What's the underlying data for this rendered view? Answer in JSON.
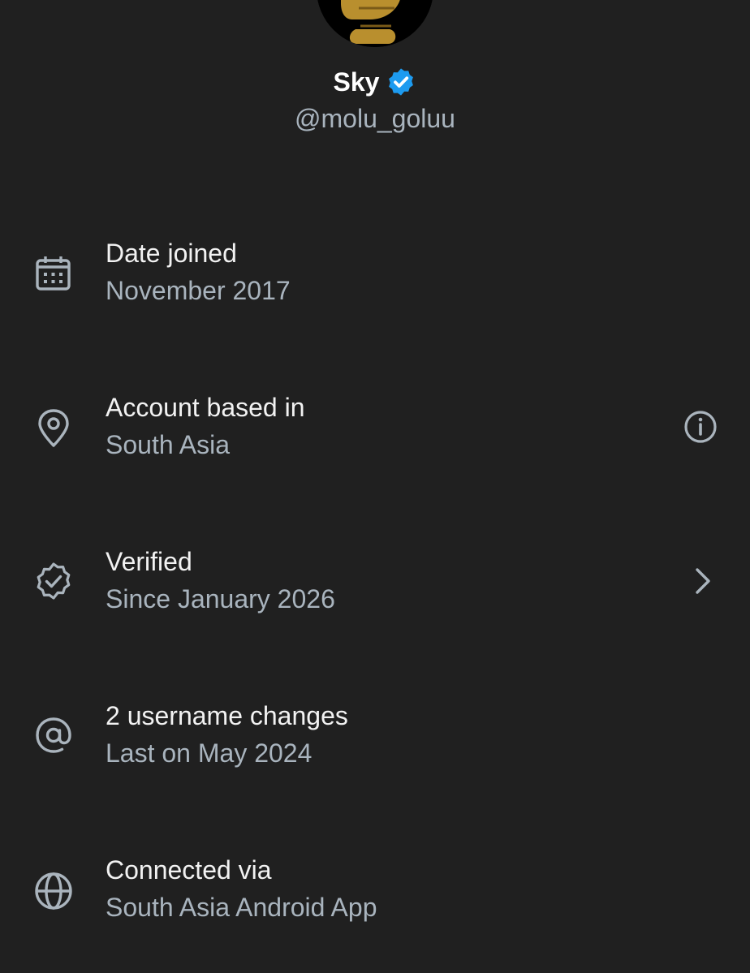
{
  "profile": {
    "name": "Sky",
    "handle": "@molu_goluu",
    "badge_color": "#1d9bf0"
  },
  "rows": [
    {
      "icon": "calendar-icon",
      "title": "Date joined",
      "subtitle": "November 2017"
    },
    {
      "icon": "location-pin-icon",
      "title": "Account based in",
      "subtitle": "South Asia",
      "action_icon": "info-icon"
    },
    {
      "icon": "verified-seal-icon",
      "title": "Verified",
      "subtitle": "Since January 2026",
      "action_icon": "chevron-right-icon"
    },
    {
      "icon": "at-sign-icon",
      "title": "2 username changes",
      "subtitle": "Last on May 2024"
    },
    {
      "icon": "globe-icon",
      "title": "Connected via",
      "subtitle": "South Asia Android App"
    }
  ],
  "colors": {
    "background": "#202020",
    "primary_text": "#f2f2f2",
    "secondary_text": "#a9b4be",
    "icon": "#aab4bd"
  }
}
